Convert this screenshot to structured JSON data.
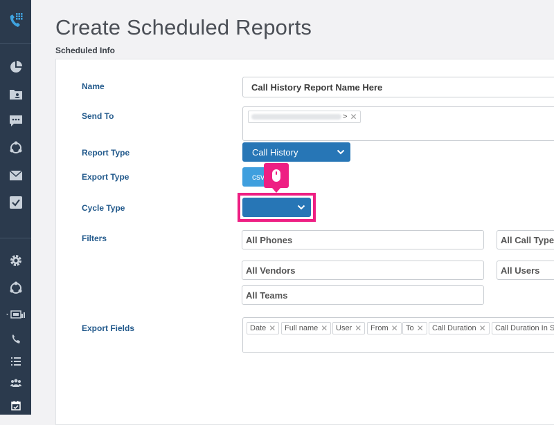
{
  "page": {
    "title": "Create Scheduled Reports",
    "section": "Scheduled Info"
  },
  "form": {
    "name_label": "Name",
    "name_value": "Call History Report Name Here",
    "send_to_label": "Send To",
    "send_to_chip_suffix": ">",
    "report_type_label": "Report Type",
    "report_type_value": "Call History",
    "export_type_label": "Export Type",
    "export_type_value": "csv",
    "cycle_type_label": "Cycle Type",
    "cycle_type_value": "",
    "filters_label": "Filters",
    "filters": {
      "phones": "All Phones",
      "call_types": "All Call Types",
      "vendors": "All Vendors",
      "users": "All Users",
      "teams": "All Teams"
    },
    "export_fields_label": "Export Fields",
    "export_fields": [
      "Date",
      "Full name",
      "User",
      "From",
      "To",
      "Call Duration",
      "Call Duration In Se"
    ]
  },
  "icons": {
    "sidebar": [
      "phone-grid-logo-icon",
      "pie-chart-icon",
      "contacts-folder-icon",
      "chat-icon",
      "network-icon",
      "mail-icon",
      "checkbox-icon",
      "gear-icon",
      "network-icon",
      "monitor-icon",
      "phone-icon",
      "list-icon",
      "users-icon",
      "calendar-check-icon"
    ],
    "cursor": "mouse-icon"
  },
  "colors": {
    "sidebar": "#2b3a4d",
    "primary": "#2776b6",
    "accent": "#ee1f83",
    "label": "#235a8c"
  }
}
